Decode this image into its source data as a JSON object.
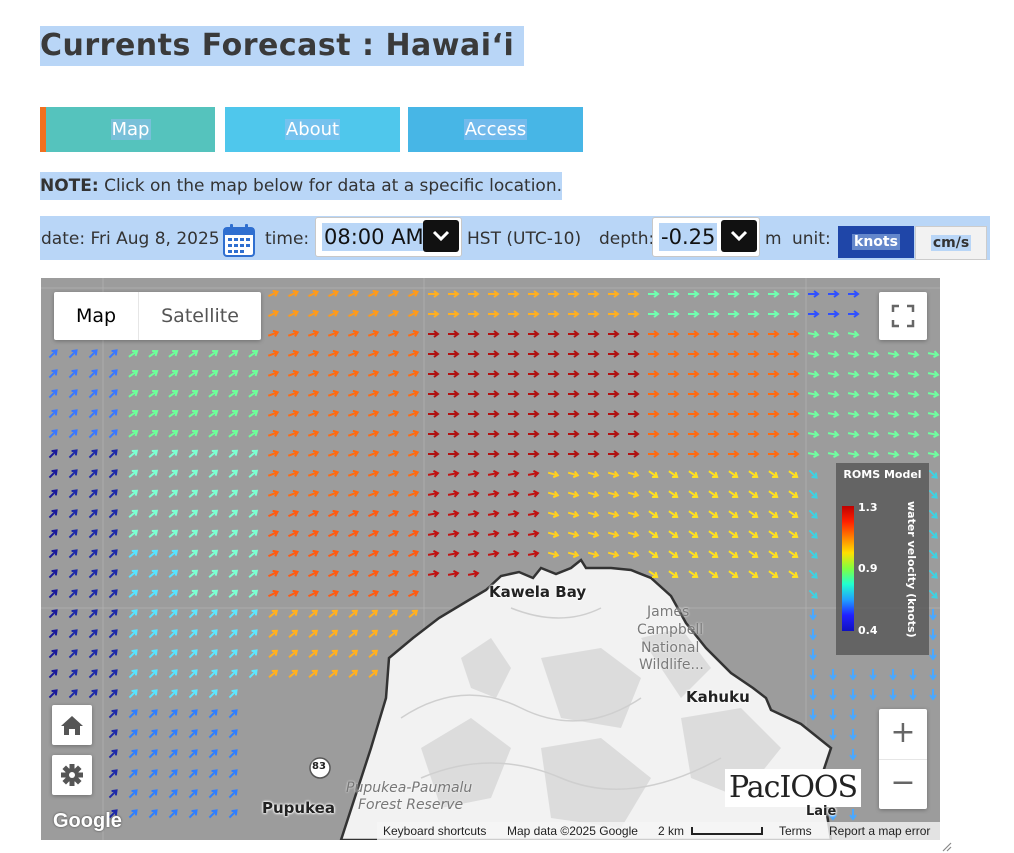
{
  "page": {
    "title": "Currents Forecast : Hawaiʻi"
  },
  "tabs": [
    {
      "label": "Map",
      "color": "#55c3bd",
      "active": true
    },
    {
      "label": "About",
      "color": "#4fc7ec"
    },
    {
      "label": "Access",
      "color": "#47b6e6"
    }
  ],
  "note": {
    "bold": "NOTE:",
    "text": " Click on the map below for data at a specific location."
  },
  "controls": {
    "date_label": "date: Fri Aug 8, 2025",
    "calendar_icon": "calendar-icon",
    "time_label": "time:",
    "time_value": "08:00 AM",
    "timezone": "HST (UTC-10)",
    "depth_label": "depth:",
    "depth_value": "-0.25",
    "depth_unit": "m",
    "unit_label": "unit:",
    "unit_options": [
      "knots",
      "cm/s"
    ],
    "unit_selected": "knots"
  },
  "map": {
    "map_type_buttons": [
      "Map",
      "Satellite"
    ],
    "map_type_selected": "Map",
    "labels": {
      "kawela_bay": "Kawela Bay",
      "james_campbell_1": "James",
      "james_campbell_2": "Campbell",
      "james_campbell_3": "National",
      "james_campbell_4": "Wildlife...",
      "kahuku": "Kahuku",
      "pupukea": "Pupukea",
      "forest_1": "Pupukea-Paumalu",
      "forest_2": "Forest Reserve",
      "laie": "Laie",
      "route": "83"
    },
    "legend": {
      "title": "ROMS Model",
      "max": "1.3",
      "mid": "0.9",
      "min": "0.4",
      "variable": "water velocity (knots)"
    },
    "logo": "PacIOOS",
    "google": "Google",
    "attribution": {
      "shortcuts": "Keyboard shortcuts",
      "data": "Map data ©2025 Google",
      "scale": "2 km",
      "terms": "Terms",
      "report": "Report a map error"
    },
    "zoom_in": "+",
    "zoom_out": "−",
    "icons": [
      "home-icon",
      "gear-icon",
      "fullscreen-icon"
    ]
  },
  "colors": {
    "unit_active_bg": "#1f46a8",
    "selection": "#b9d6f7",
    "map_bg": "#9c9c9c"
  }
}
